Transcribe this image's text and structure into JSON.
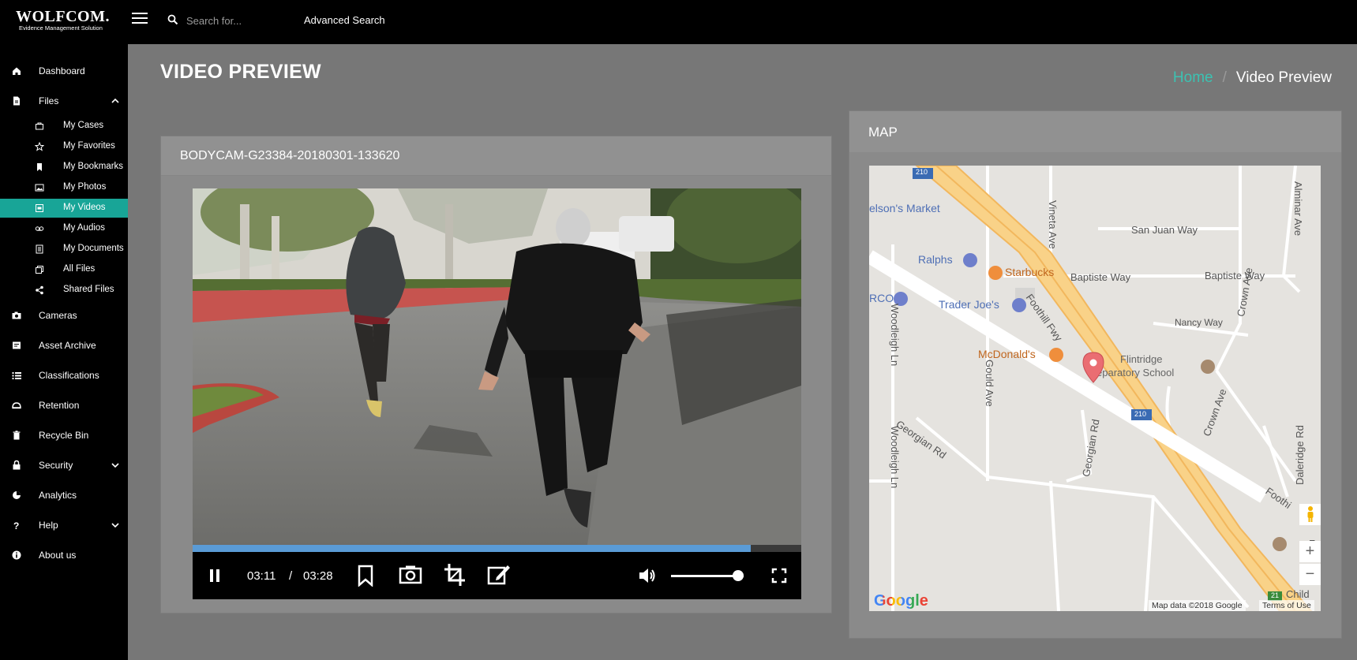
{
  "brand": {
    "name": "WOLFCOM.",
    "tagline": "Evidence Management Solution"
  },
  "topbar": {
    "search_placeholder": "Search for...",
    "advanced_search": "Advanced Search"
  },
  "sidebar": {
    "items": [
      {
        "label": "Dashboard",
        "icon": "home-icon"
      },
      {
        "label": "Files",
        "icon": "file-icon"
      },
      {
        "label": "Cameras",
        "icon": "camera-icon"
      },
      {
        "label": "Asset Archive",
        "icon": "archive-icon"
      },
      {
        "label": "Classifications",
        "icon": "list-icon"
      },
      {
        "label": "Retention",
        "icon": "retention-icon"
      },
      {
        "label": "Recycle Bin",
        "icon": "trash-icon"
      },
      {
        "label": "Security",
        "icon": "lock-icon"
      },
      {
        "label": "Analytics",
        "icon": "pie-chart-icon"
      },
      {
        "label": "Help",
        "icon": "question-icon"
      },
      {
        "label": "About us",
        "icon": "info-icon"
      }
    ],
    "files_sub": [
      {
        "label": "My Cases",
        "icon": "briefcase-icon"
      },
      {
        "label": "My Favorites",
        "icon": "star-icon"
      },
      {
        "label": "My Bookmarks",
        "icon": "bookmark-icon"
      },
      {
        "label": "My Photos",
        "icon": "photo-icon"
      },
      {
        "label": "My Videos",
        "icon": "film-icon",
        "active": true
      },
      {
        "label": "My Audios",
        "icon": "audio-icon"
      },
      {
        "label": "My Documents",
        "icon": "document-icon"
      },
      {
        "label": "All Files",
        "icon": "copy-icon"
      },
      {
        "label": "Shared Files",
        "icon": "share-icon"
      }
    ]
  },
  "page": {
    "title": "VIDEO PREVIEW",
    "breadcrumb_home": "Home",
    "breadcrumb_sep": "/",
    "breadcrumb_current": "Video Preview"
  },
  "video": {
    "title": "BODYCAM-G23384-20180301-133620",
    "current_time": "03:11",
    "time_sep": "/",
    "duration": "03:28",
    "progress": 0.917,
    "volume": 0.92
  },
  "map": {
    "title": "MAP",
    "labels": {
      "nelsons": "elson's Market",
      "ralphs": "Ralphs",
      "starbucks": "Starbucks",
      "rco": "RCO",
      "traderjoes": "Trader Joe's",
      "mcdonalds": "McDonald's",
      "flintridge1": "Flintridge",
      "flintridge2": "eparatory School",
      "sanjuan": "San Juan Way",
      "baptiste1": "Baptiste Way",
      "baptiste2": "Baptiste Way",
      "nancy": "Nancy Way",
      "foothill": "Foothill Fwy",
      "vineta": "Vineta Ave",
      "alminar": "Alminar Ave",
      "crown1": "Crown Ave",
      "crown2": "Crown Ave",
      "woodleigh1": "Woodleigh Ln",
      "woodleigh2": "Woodleigh Ln",
      "gould": "Gould Ave",
      "georgian_rd": "Georgian Rd",
      "georgian_rd2": "Georgian Rd",
      "daleridge": "Daleridge Rd",
      "route210a": "210",
      "route210b": "210",
      "route21": "21",
      "child": "Child",
      "foothill_edge": "Foothi",
      "fr": "Fr"
    },
    "google": "Google",
    "attribution": "Map data ©2018 Google",
    "terms": "Terms of Use",
    "zoom_in": "+",
    "zoom_out": "−"
  },
  "colors": {
    "accent": "#18a597",
    "breadcrumb_link": "#3cc2b2",
    "progress": "#5a9bd6"
  }
}
